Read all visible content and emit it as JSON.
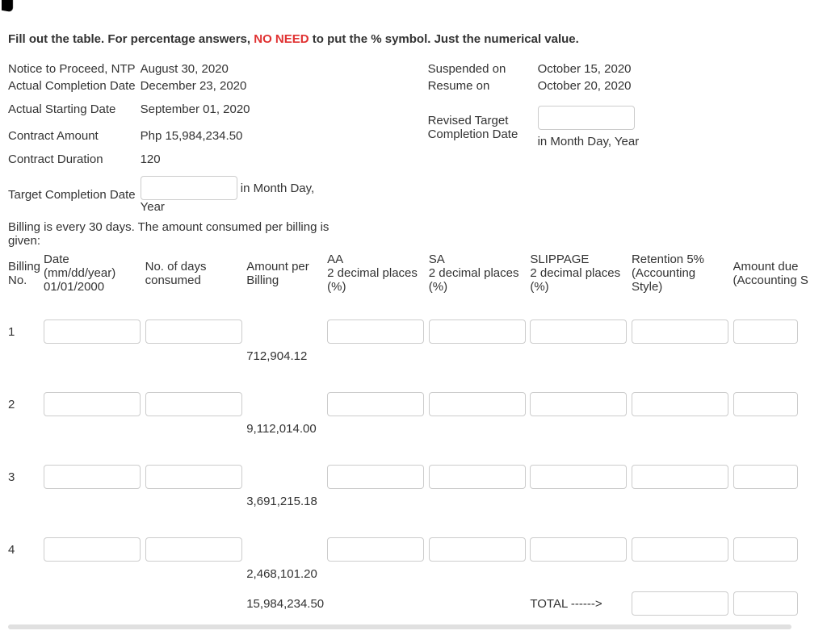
{
  "instruction": {
    "pre": "Fill out the table. For percentage answers, ",
    "em": "NO NEED",
    "post": " to put the % symbol. Just the numerical value."
  },
  "meta_left": {
    "ntp_lbl": "Notice to Proceed, NTP",
    "ntp_val": "August 30, 2020",
    "acd_lbl": "Actual Completion Date",
    "acd_val": "December 23, 2020",
    "asd_lbl": "Actual Starting Date",
    "asd_val": "September 01, 2020",
    "ca_lbl": "Contract Amount",
    "ca_val": "Php 15,984,234.50",
    "cd_lbl": "Contract Duration",
    "cd_val": "120",
    "tcd_lbl": "Target Completion Date",
    "tcd_hint": "in Month Day, Year"
  },
  "meta_right": {
    "susp_lbl": "Suspended on",
    "susp_val": "October 15, 2020",
    "res_lbl": "Resume on",
    "res_val": "October 20, 2020",
    "rtcd_lbl": "Revised Target Completion Date",
    "rtcd_hint": "in Month Day, Year"
  },
  "billing_note": "Billing is every 30 days. The amount consumed per billing is given:",
  "head": {
    "bn": "Billing No.",
    "dt1": "Date",
    "dt2": "(mm/dd/year)",
    "dt3": "01/01/2000",
    "nd": "No. of days consumed",
    "ap": "Amount per Billing",
    "aa1": "AA",
    "aa2": "2 decimal places (%)",
    "sa1": "SA",
    "sa2": "2 decimal places (%)",
    "sl1": "SLIPPAGE",
    "sl2": "2 decimal places (%)",
    "rt1": "Retention 5%",
    "rt2": "(Accounting Style)",
    "ad1": "Amount due",
    "ad2": "(Accounting S"
  },
  "rows": [
    {
      "n": "1",
      "amount": "712,904.12"
    },
    {
      "n": "2",
      "amount": "9,112,014.00"
    },
    {
      "n": "3",
      "amount": "3,691,215.18"
    },
    {
      "n": "4",
      "amount": "2,468,101.20"
    }
  ],
  "total": {
    "amount": "15,984,234.50",
    "label": "TOTAL ------>"
  }
}
